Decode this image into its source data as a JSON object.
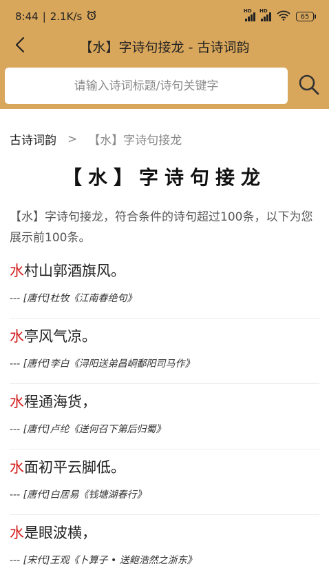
{
  "status": {
    "time": "8:44",
    "speed": "2.1K/s",
    "battery": "65",
    "hd1": "HD",
    "hd2": "HD"
  },
  "header": {
    "title": "【水】字诗句接龙 - 古诗词韵"
  },
  "search": {
    "placeholder": "请输入诗词标题/诗句关键字"
  },
  "breadcrumb": {
    "root": "古诗词韵",
    "separator": ">",
    "current": "【水】字诗句接龙"
  },
  "page": {
    "title": "【水】字诗句接龙",
    "intro": "【水】字诗句接龙，符合条件的诗句超过100条，以下为您展示前100条。"
  },
  "items": [
    {
      "head": "水",
      "rest": "村山郭酒旗风。",
      "source": "--- [唐代]杜牧《江南春绝句》"
    },
    {
      "head": "水",
      "rest": "亭风气凉。",
      "source": "--- [唐代]李白《浔阳送弟昌峒鄱阳司马作》"
    },
    {
      "head": "水",
      "rest": "程通海货，",
      "source": "--- [唐代]卢纶《送何召下第后归蜀》"
    },
    {
      "head": "水",
      "rest": "面初平云脚低。",
      "source": "--- [唐代]白居易《钱塘湖春行》"
    },
    {
      "head": "水",
      "rest": "是眼波横，",
      "source": "--- [宋代]王观《卜算子 • 送鲍浩然之浙东》"
    }
  ],
  "colors": {
    "header_bg": "#d9a75c",
    "highlight": "#d21c1c"
  },
  "icons": {
    "back": "back-arrow-icon",
    "search": "search-icon",
    "alarm": "alarm-clock-icon",
    "wifi": "wifi-icon"
  }
}
